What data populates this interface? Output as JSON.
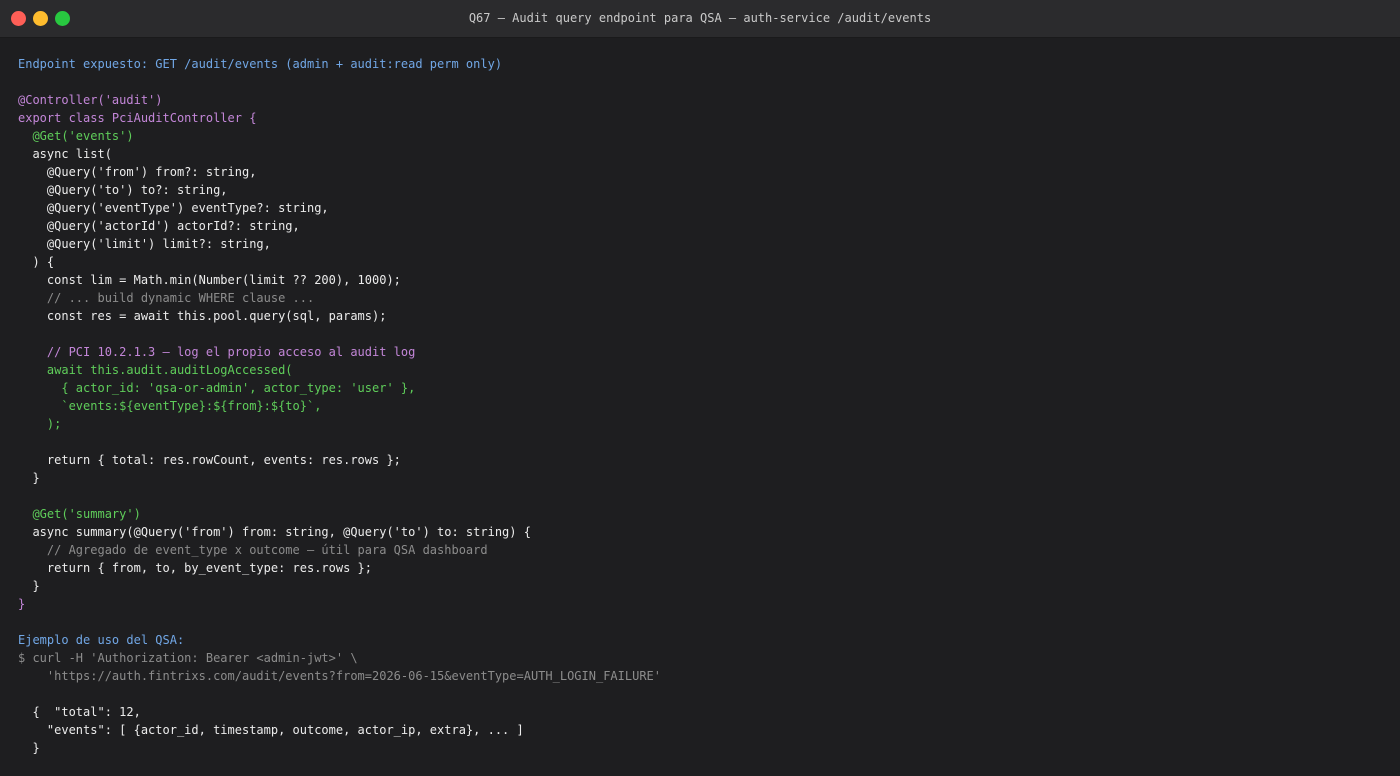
{
  "window": {
    "title": "Q67 — Audit query endpoint para QSA — auth-service /audit/events"
  },
  "colors": {
    "background": "#1e1e20",
    "titlebar": "#2b2b2d",
    "blue": "#71a7e6",
    "purple": "#c386d8",
    "green": "#5fcd5a",
    "white": "#ececec",
    "gray": "#8c8c8c"
  },
  "terminal": {
    "lines": [
      {
        "text": "Endpoint expuesto: GET /audit/events (admin + audit:read perm only)",
        "color": "blue"
      },
      {
        "text": "",
        "color": "white"
      },
      {
        "text": "@Controller('audit')",
        "color": "purple"
      },
      {
        "text": "export class PciAuditController {",
        "color": "purple"
      },
      {
        "text": "  @Get('events')",
        "color": "green"
      },
      {
        "text": "  async list(",
        "color": "white"
      },
      {
        "text": "    @Query('from') from?: string,",
        "color": "white"
      },
      {
        "text": "    @Query('to') to?: string,",
        "color": "white"
      },
      {
        "text": "    @Query('eventType') eventType?: string,",
        "color": "white"
      },
      {
        "text": "    @Query('actorId') actorId?: string,",
        "color": "white"
      },
      {
        "text": "    @Query('limit') limit?: string,",
        "color": "white"
      },
      {
        "text": "  ) {",
        "color": "white"
      },
      {
        "text": "    const lim = Math.min(Number(limit ?? 200), 1000);",
        "color": "white"
      },
      {
        "text": "    // ... build dynamic WHERE clause ...",
        "color": "gray"
      },
      {
        "text": "    const res = await this.pool.query(sql, params);",
        "color": "white"
      },
      {
        "text": "",
        "color": "white"
      },
      {
        "text": "    // PCI 10.2.1.3 — log el propio acceso al audit log",
        "color": "purple"
      },
      {
        "text": "    await this.audit.auditLogAccessed(",
        "color": "green"
      },
      {
        "text": "      { actor_id: 'qsa-or-admin', actor_type: 'user' },",
        "color": "green"
      },
      {
        "text": "      `events:${eventType}:${from}:${to}`,",
        "color": "green"
      },
      {
        "text": "    );",
        "color": "green"
      },
      {
        "text": "",
        "color": "white"
      },
      {
        "text": "    return { total: res.rowCount, events: res.rows };",
        "color": "white"
      },
      {
        "text": "  }",
        "color": "white"
      },
      {
        "text": "",
        "color": "white"
      },
      {
        "text": "  @Get('summary')",
        "color": "green"
      },
      {
        "text": "  async summary(@Query('from') from: string, @Query('to') to: string) {",
        "color": "white"
      },
      {
        "text": "    // Agregado de event_type x outcome — útil para QSA dashboard",
        "color": "gray"
      },
      {
        "text": "    return { from, to, by_event_type: res.rows };",
        "color": "white"
      },
      {
        "text": "  }",
        "color": "white"
      },
      {
        "text": "}",
        "color": "purple"
      },
      {
        "text": "",
        "color": "white"
      },
      {
        "text": "Ejemplo de uso del QSA:",
        "color": "blue"
      },
      {
        "text": "$ curl -H 'Authorization: Bearer <admin-jwt>' \\",
        "color": "gray"
      },
      {
        "text": "    'https://auth.fintrixs.com/audit/events?from=2026-06-15&eventType=AUTH_LOGIN_FAILURE'",
        "color": "gray"
      },
      {
        "text": "",
        "color": "white"
      },
      {
        "text": "  {  \"total\": 12,",
        "color": "white"
      },
      {
        "text": "    \"events\": [ {actor_id, timestamp, outcome, actor_ip, extra}, ... ]",
        "color": "white"
      },
      {
        "text": "  }",
        "color": "white"
      }
    ]
  }
}
